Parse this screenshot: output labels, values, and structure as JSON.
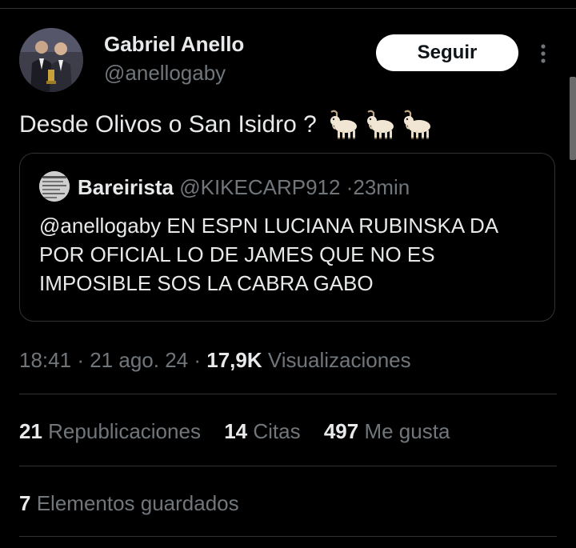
{
  "author": {
    "name": "Gabriel Anello",
    "handle": "@anellogaby"
  },
  "follow_button": {
    "label": "Seguir"
  },
  "more_icon": "more-vertical-icon",
  "tweet": {
    "text": "Desde Olivos o San Isidro ?",
    "emoji": [
      "goat-icon",
      "goat-icon",
      "goat-icon"
    ]
  },
  "quote": {
    "name": "Bareirista",
    "handle": "@KIKECARP912",
    "separator": "·",
    "time": "23min",
    "text": "@anellogaby  EN ESPN LUCIANA RUBINSKA DA POR OFICIAL LO DE JAMES QUE NO ES IMPOSIBLE SOS LA CABRA GABO"
  },
  "meta": {
    "time": "18:41",
    "sep1": "·",
    "date": "21 ago. 24",
    "sep2": "·",
    "views_count": "17,9K",
    "views_label": "Visualizaciones"
  },
  "stats": {
    "reposts_count": "21",
    "reposts_label": "Republicaciones",
    "quotes_count": "14",
    "quotes_label": "Citas",
    "likes_count": "497",
    "likes_label": "Me gusta"
  },
  "bookmarks": {
    "count": "7",
    "label": "Elementos guardados"
  },
  "colors": {
    "background": "#000000",
    "text_primary": "#e7e9ea",
    "text_secondary": "#71767b",
    "border": "#2f3336",
    "button_bg": "#ffffff"
  }
}
